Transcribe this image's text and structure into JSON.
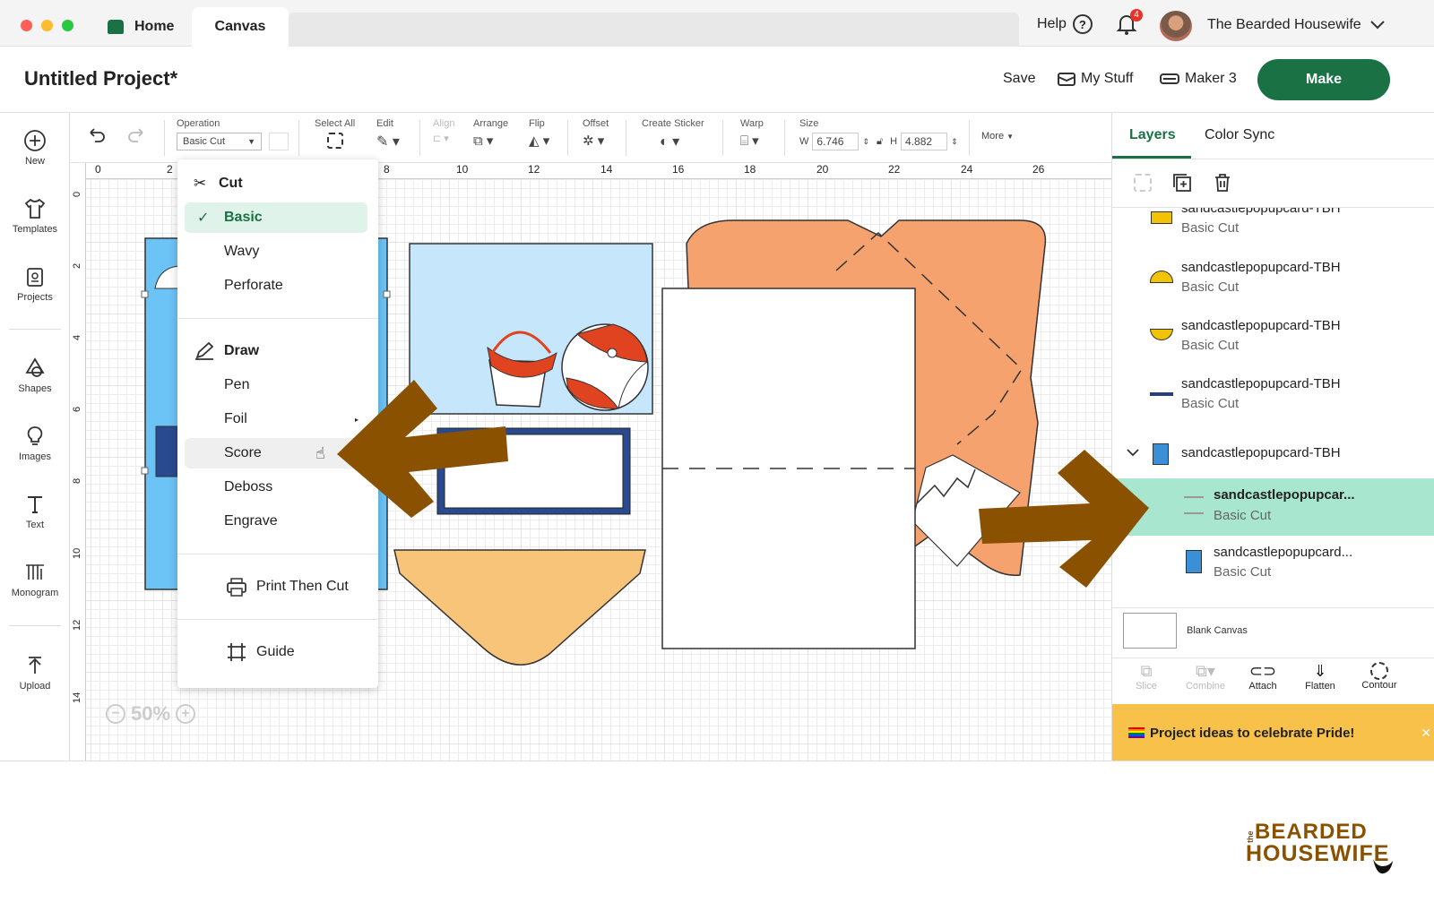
{
  "tabs": {
    "home": "Home",
    "canvas": "Canvas"
  },
  "top_right": {
    "help": "Help",
    "notification_count": "4",
    "user_name": "The Bearded Housewife"
  },
  "header": {
    "title": "Untitled Project*",
    "save": "Save",
    "my_stuff": "My Stuff",
    "machine": "Maker 3",
    "make": "Make"
  },
  "sidebar": {
    "items": [
      {
        "label": "New",
        "icon": "plus-circle-icon"
      },
      {
        "label": "Templates",
        "icon": "shirt-icon"
      },
      {
        "label": "Projects",
        "icon": "projects-icon"
      },
      {
        "label": "Shapes",
        "icon": "shapes-icon"
      },
      {
        "label": "Images",
        "icon": "lightbulb-icon"
      },
      {
        "label": "Text",
        "icon": "text-icon"
      },
      {
        "label": "Monogram",
        "icon": "monogram-icon"
      },
      {
        "label": "Upload",
        "icon": "upload-icon"
      }
    ]
  },
  "toolbar": {
    "operation_label": "Operation",
    "operation_value": "Basic Cut",
    "select_all": "Select All",
    "edit": "Edit",
    "align": "Align",
    "arrange": "Arrange",
    "flip": "Flip",
    "offset": "Offset",
    "create_sticker": "Create Sticker",
    "warp": "Warp",
    "size": "Size",
    "w_label": "W",
    "w_value": "6.746",
    "h_label": "H",
    "h_value": "4.882",
    "more": "More"
  },
  "ruler": {
    "top": [
      "0",
      "2",
      "8",
      "10",
      "12",
      "14",
      "16",
      "18",
      "20",
      "22",
      "24",
      "26"
    ],
    "left": [
      "0",
      "2",
      "4",
      "6",
      "8",
      "10",
      "12",
      "14"
    ]
  },
  "zoom": "50%",
  "menu": {
    "cut_header": "Cut",
    "cut_items": [
      "Basic",
      "Wavy",
      "Perforate"
    ],
    "draw_header": "Draw",
    "draw_items": [
      "Pen",
      "Foil",
      "Score",
      "Deboss",
      "Engrave"
    ],
    "print_then_cut": "Print Then Cut",
    "guide": "Guide",
    "selected": "Basic",
    "hovered": "Score"
  },
  "right_panel": {
    "tab_layers": "Layers",
    "tab_color_sync": "Color Sync",
    "layers": [
      {
        "name": "sandcastlepopupcard-TBH",
        "sub": "Basic Cut",
        "color": "#f2c300"
      },
      {
        "name": "sandcastlepopupcard-TBH",
        "sub": "Basic Cut",
        "color": "#f2c300"
      },
      {
        "name": "sandcastlepopupcard-TBH",
        "sub": "Basic Cut",
        "color": "#f2c300"
      },
      {
        "name": "sandcastlepopupcard-TBH",
        "sub": "Basic Cut",
        "color": "#2a3f7a"
      },
      {
        "name": "sandcastlepopupcard-TBH",
        "sub": "",
        "color": "#3a8fd6"
      },
      {
        "name": "sandcastlepopupcar...",
        "sub": "Basic Cut",
        "color": "#999999"
      },
      {
        "name": "sandcastlepopupcard...",
        "sub": "Basic Cut",
        "color": "#3a8fd6"
      }
    ],
    "blank_canvas": "Blank Canvas",
    "tools": [
      "Slice",
      "Combine",
      "Attach",
      "Flatten",
      "Contour"
    ],
    "promo": "Project ideas to celebrate Pride!"
  },
  "logo": {
    "line1": "BEARDED",
    "line2": "HOUSEWIFE",
    "prefix": "the"
  },
  "colors": {
    "make_button": "#1a7244",
    "selected_layer": "#a8e6cf",
    "arrow": "#8a5200",
    "promo": "#f7c14a",
    "accent": "#1a7244"
  }
}
